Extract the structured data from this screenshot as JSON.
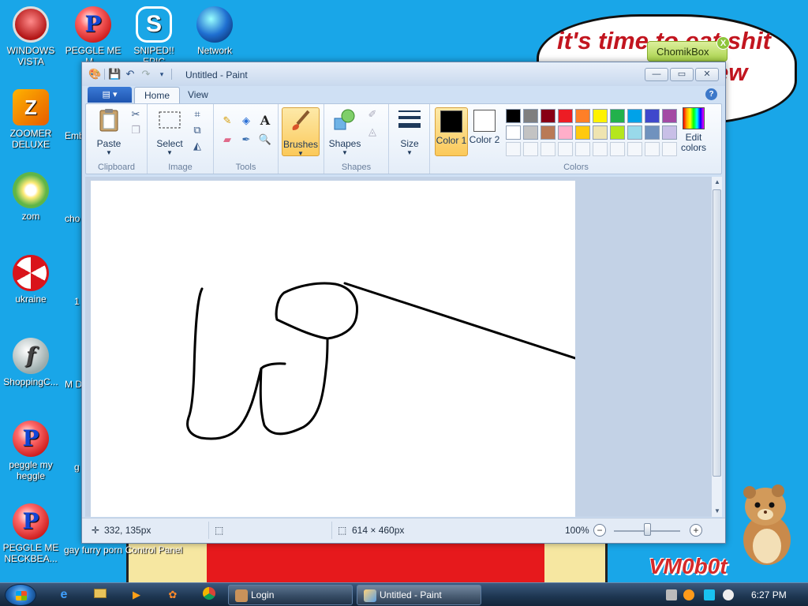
{
  "desktop": {
    "icons": [
      {
        "label": "WINDOWS VISTA"
      },
      {
        "label": "PEGGLE ME M..."
      },
      {
        "label": "SNIPED!! EPIC"
      },
      {
        "label": "Network"
      },
      {
        "label": "ZOOMER DELUXE"
      },
      {
        "label": "zom"
      },
      {
        "label": "ukraine"
      },
      {
        "label": "ShoppingC..."
      },
      {
        "label": "peggle my heggle"
      },
      {
        "label": "PEGGLE ME NECKBEA..."
      },
      {
        "label": "gay furry porn"
      },
      {
        "label": "Control Panel"
      }
    ],
    "partial_labels": [
      "Emb D...",
      "cho",
      "1",
      "M DES",
      "g"
    ],
    "speech_text": "it's time to eat shit",
    "speech_text2": "ew",
    "chomikbox": {
      "label": "ChomikBox",
      "close": "X"
    },
    "watermark": "VM0b0t"
  },
  "paint": {
    "title": "Untitled - Paint",
    "tabs": {
      "home": "Home",
      "view": "View"
    },
    "groups": {
      "clipboard": {
        "label": "Clipboard",
        "paste": "Paste"
      },
      "image": {
        "label": "Image",
        "select": "Select"
      },
      "tools": {
        "label": "Tools"
      },
      "brushes": {
        "label": "Brushes"
      },
      "shapes": {
        "label": "Shapes",
        "button": "Shapes"
      },
      "size": {
        "label": "Size"
      },
      "colors": {
        "label": "Colors",
        "color1": "Color 1",
        "color1_num": "1",
        "color2": "Color 2",
        "color2_num": "2",
        "edit": "Edit colors",
        "color1_value": "#000000",
        "color2_value": "#ffffff",
        "palette_row1": [
          "#000000",
          "#7f7f7f",
          "#880015",
          "#ed1c24",
          "#ff7f27",
          "#fff200",
          "#22b14c",
          "#00a2e8",
          "#3f48cc",
          "#a349a4"
        ],
        "palette_row2": [
          "#ffffff",
          "#c3c3c3",
          "#b97a57",
          "#ffaec9",
          "#ffc90e",
          "#efe4b0",
          "#b5e61d",
          "#99d9ea",
          "#7092be",
          "#c8bfe7"
        ]
      }
    },
    "status": {
      "cursor_pos": "332, 135px",
      "canvas_size": "614 × 460px",
      "zoom": "100%"
    }
  },
  "taskbar": {
    "tasks": [
      {
        "label": "Login"
      },
      {
        "label": "Untitled - Paint"
      }
    ],
    "clock": "6:27 PM"
  }
}
